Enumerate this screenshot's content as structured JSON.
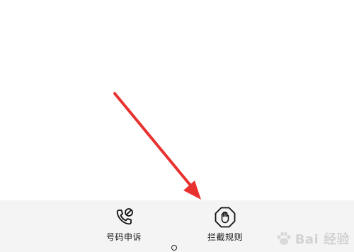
{
  "bottom_bar": {
    "actions": [
      {
        "label": "号码申诉",
        "icon": "phone-blocked-icon"
      },
      {
        "label": "拦截规则",
        "icon": "hand-stop-icon"
      }
    ]
  },
  "nav": {
    "home_icon": "home-circle-icon"
  },
  "annotation": {
    "arrow_color": "#e8322f"
  },
  "watermark": {
    "text": "Bai 经验",
    "icon": "paw-icon"
  }
}
